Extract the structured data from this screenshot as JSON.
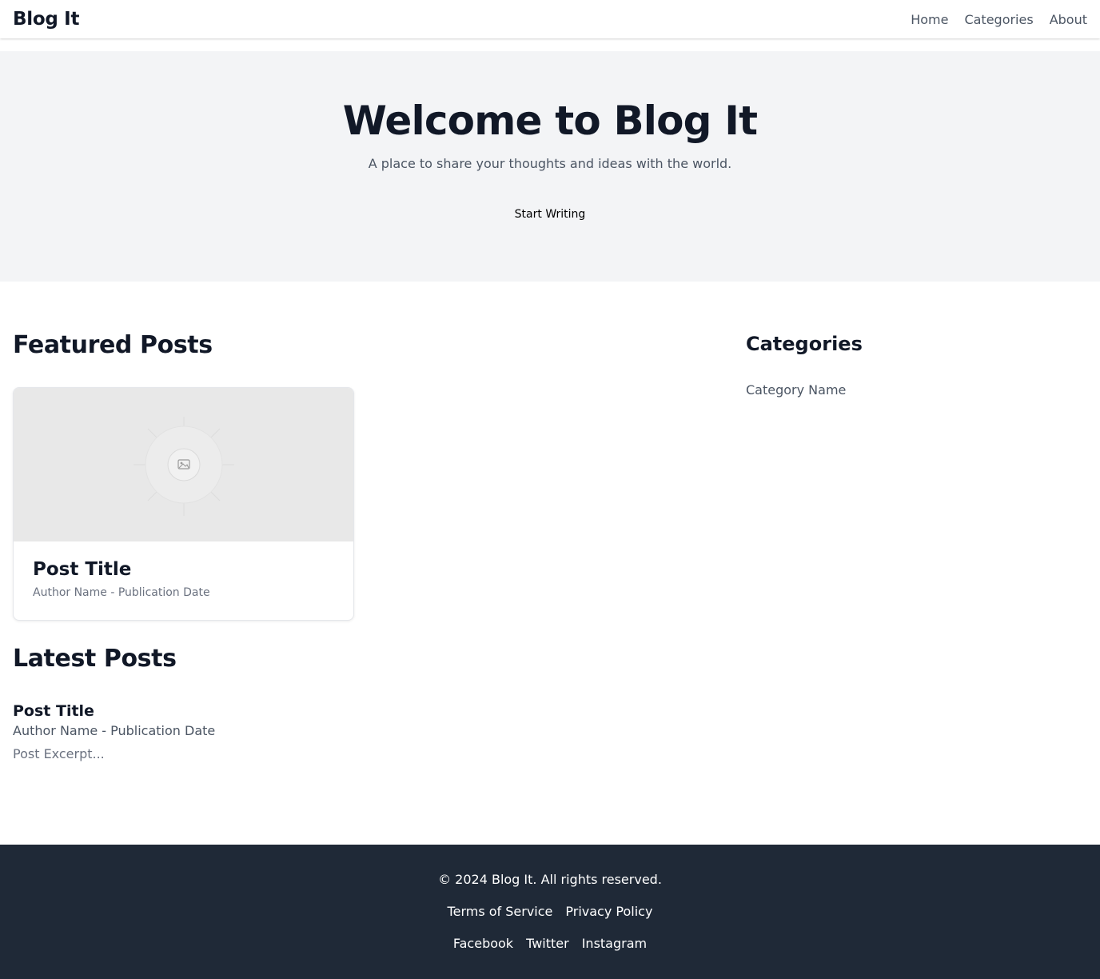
{
  "header": {
    "logo": "Blog It",
    "nav": [
      "Home",
      "Categories",
      "About"
    ]
  },
  "hero": {
    "title": "Welcome to Blog It",
    "subtitle": "A place to share your thoughts and ideas with the world.",
    "cta_label": "Start Writing"
  },
  "featured": {
    "heading": "Featured Posts",
    "card": {
      "image_icon": "image-placeholder-icon",
      "title": "Post Title",
      "meta": "Author Name - Publication Date"
    }
  },
  "latest": {
    "heading": "Latest Posts",
    "post": {
      "title": "Post Title",
      "meta": "Author Name - Publication Date",
      "excerpt": "Post Excerpt..."
    }
  },
  "sidebar": {
    "heading": "Categories",
    "items": [
      "Category Name"
    ]
  },
  "footer": {
    "copyright": "© 2024 Blog It. All rights reserved.",
    "links": [
      "Terms of Service",
      "Privacy Policy"
    ],
    "social": [
      "Facebook",
      "Twitter",
      "Instagram"
    ]
  },
  "colors": {
    "hero_bg": "#f3f4f6",
    "footer_bg": "#1f2937",
    "text_dark": "#111827",
    "text_muted": "#4b5563"
  }
}
